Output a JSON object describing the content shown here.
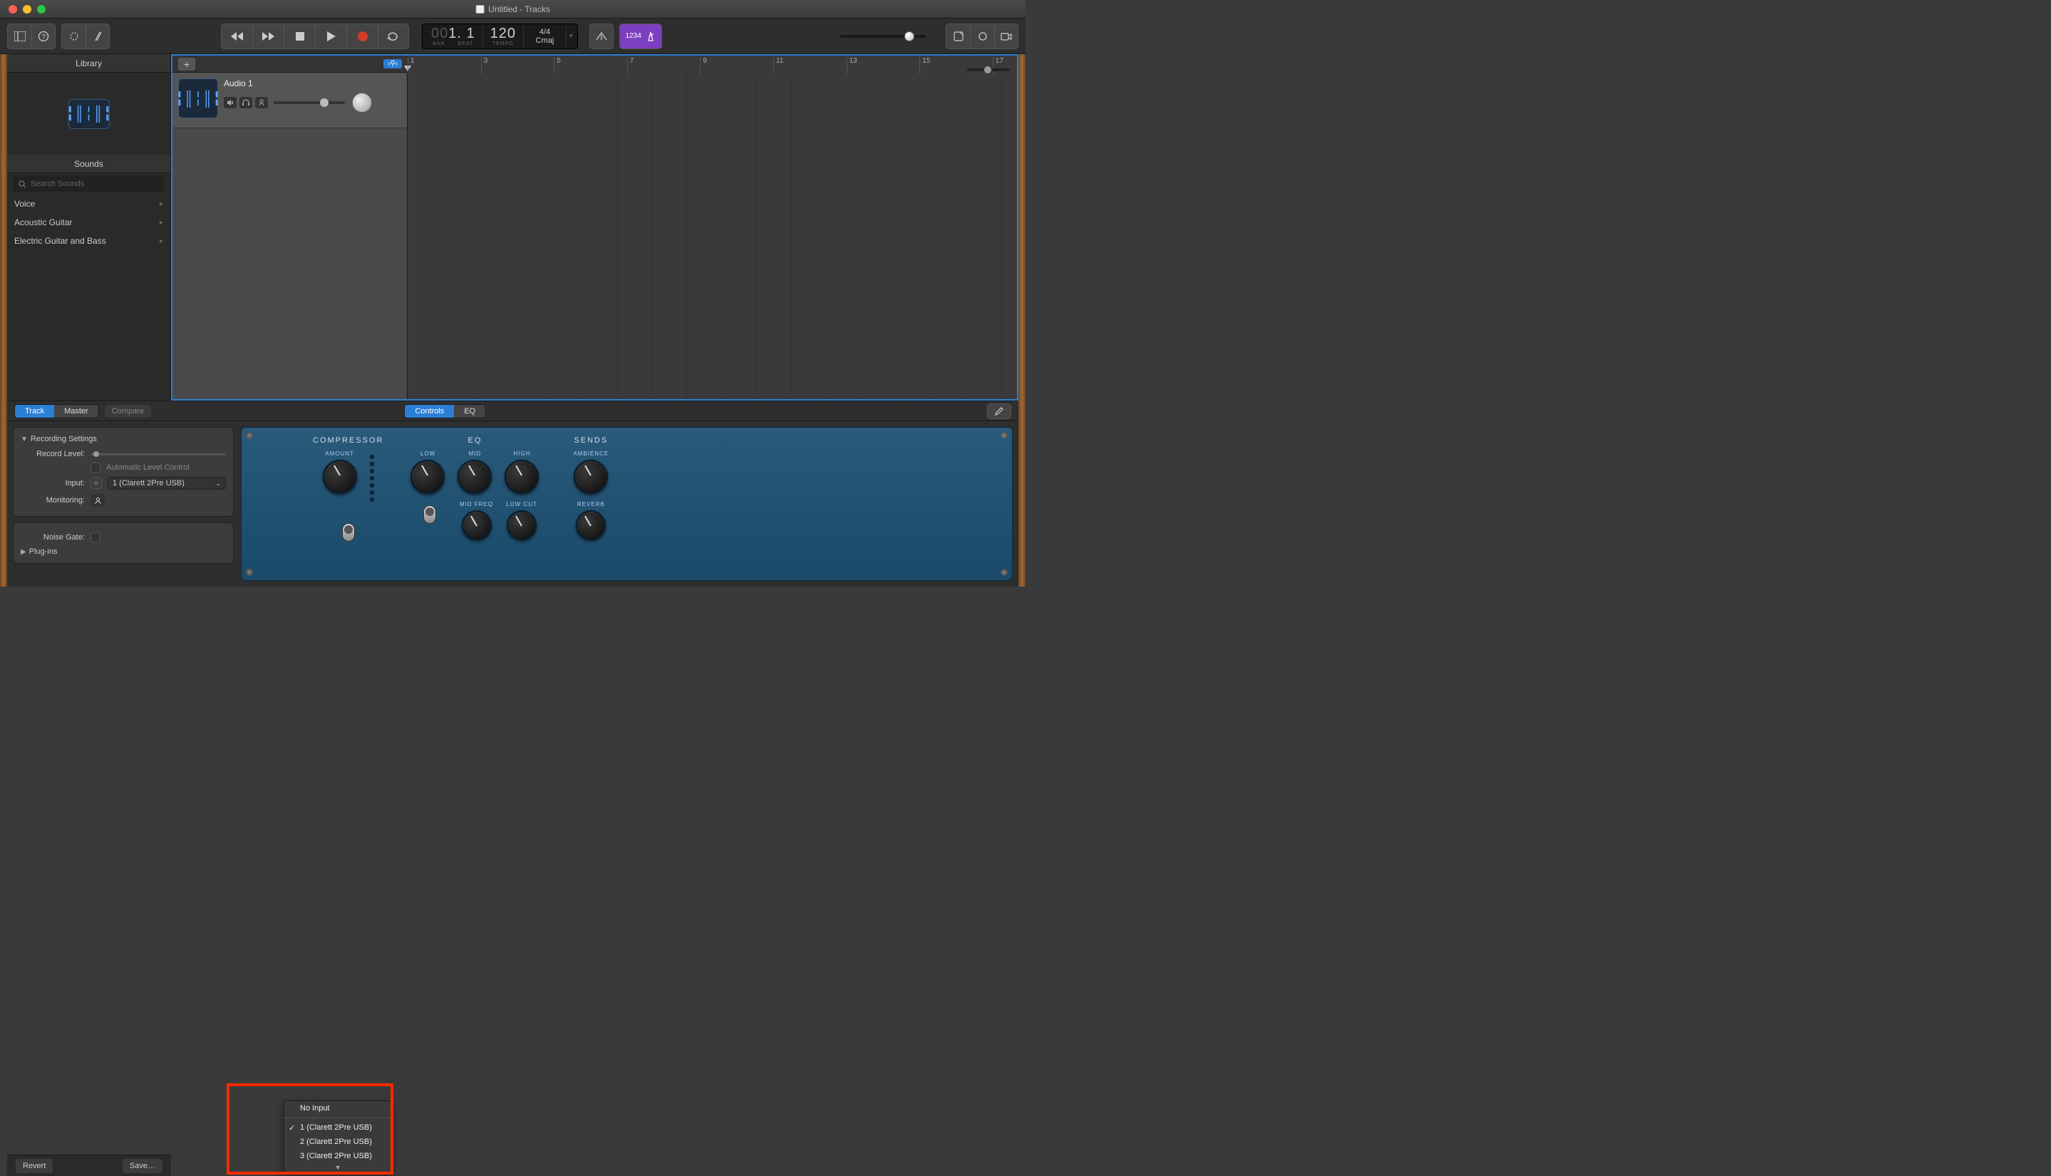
{
  "window": {
    "title": "Untitled - Tracks"
  },
  "lcd": {
    "bars_dim": "00",
    "bars": "1",
    "beats": "1",
    "bar_lbl": "BAR",
    "beat_lbl": "BEAT",
    "tempo": "120",
    "tempo_lbl": "TEMPO",
    "sig": "4/4",
    "key": "Cmaj"
  },
  "tuner_text": "1234",
  "library": {
    "title": "Library",
    "sounds_title": "Sounds",
    "search_placeholder": "Search Sounds",
    "categories": [
      "Voice",
      "Acoustic Guitar",
      "Electric Guitar and Bass"
    ],
    "revert": "Revert",
    "save": "Save…"
  },
  "ruler_nums": [
    "1",
    "3",
    "5",
    "7",
    "9",
    "11",
    "13",
    "15",
    "17"
  ],
  "track": {
    "name": "Audio 1"
  },
  "editor": {
    "tab_track": "Track",
    "tab_master": "Master",
    "compare": "Compare",
    "tab_controls": "Controls",
    "tab_eq": "EQ",
    "rec_title": "Recording Settings",
    "rec_level": "Record Level:",
    "auto_level": "Automatic Level Control",
    "input_lbl": "Input:",
    "input_val": "1  (Clarett 2Pre USB)",
    "monitoring": "Monitoring:",
    "noise_gate": "Noise Gate:",
    "plugins": "Plug-ins",
    "menu": {
      "no_input": "No Input",
      "items": [
        "1  (Clarett 2Pre USB)",
        "2  (Clarett 2Pre USB)",
        "3  (Clarett 2Pre USB)"
      ]
    }
  },
  "plugin": {
    "comp": "COMPRESSOR",
    "amount": "AMOUNT",
    "eq": "EQ",
    "low": "LOW",
    "mid": "MID",
    "high": "HIGH",
    "midfreq": "MID FREQ",
    "lowcut": "LOW CUT",
    "sends": "SENDS",
    "ambience": "AMBIENCE",
    "reverb": "REVERB"
  }
}
